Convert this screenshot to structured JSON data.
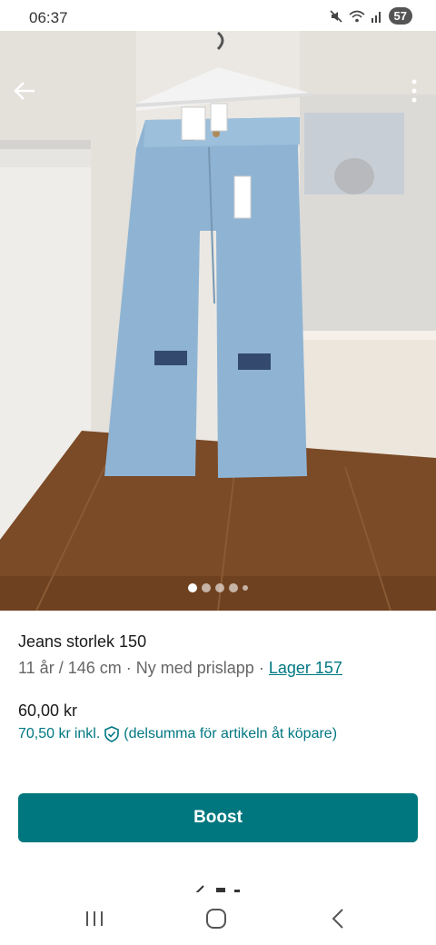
{
  "status_bar": {
    "time": "06:37",
    "battery": "57",
    "icons": [
      "mute-icon",
      "wifi-icon",
      "signal-icon",
      "battery-icon"
    ]
  },
  "listing": {
    "title": "Jeans storlek 150",
    "size": "11 år / 146 cm",
    "separator": "·",
    "condition": "Ny med prislapp",
    "brand": "Lager 157",
    "price": "60,00 kr",
    "total_price": "70,50 kr",
    "total_label": "inkl.",
    "total_note": "(delsumma för artikeln åt köpare)",
    "photo_count": 5,
    "active_photo_index": 0
  },
  "actions": {
    "boost_label": "Boost"
  },
  "colors": {
    "accent": "#007782",
    "button": "#00777f"
  },
  "nav_bar": {
    "icons": [
      "recents-icon",
      "home-icon",
      "back-nav-icon"
    ]
  }
}
